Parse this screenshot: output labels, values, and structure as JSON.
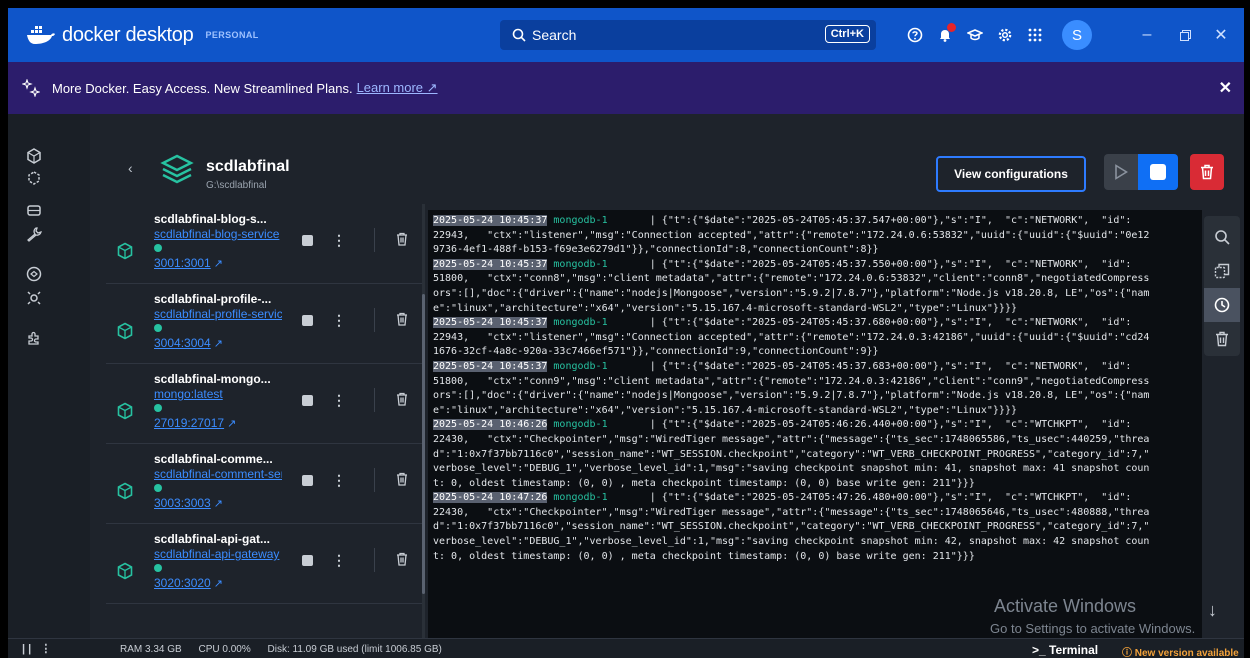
{
  "app": {
    "brand": "docker desktop",
    "tier": "PERSONAL",
    "search_label": "Search",
    "search_shortcut": "Ctrl+K",
    "avatar_initial": "S",
    "accent_color": "#0f55c9"
  },
  "banner": {
    "text": "More Docker. Easy Access. New Streamlined Plans.",
    "link": "Learn more ↗"
  },
  "project": {
    "name": "scdlabfinal",
    "path": "G:\\scdlabfinal",
    "view_config_label": "View configurations"
  },
  "containers": [
    {
      "name": "scdlabfinal-blog-s...",
      "image": "scdlabfinal-blog-service",
      "port": "3001:3001"
    },
    {
      "name": "scdlabfinal-profile-...",
      "image": "scdlabfinal-profile-service",
      "port": "3004:3004"
    },
    {
      "name": "scdlabfinal-mongo...",
      "image": "mongo:latest",
      "port": "27019:27017"
    },
    {
      "name": "scdlabfinal-comme...",
      "image": "scdlabfinal-comment-service",
      "port": "3003:3003"
    },
    {
      "name": "scdlabfinal-api-gat...",
      "image": "scdlabfinal-api-gateway",
      "port": "3020:3020"
    }
  ],
  "logs": [
    {
      "ts": "2025-05-24 10:45:37",
      "svc": "mongodb-1",
      "lines": [
        "       | {\"t\":{\"$date\":\"2025-05-24T05:45:37.547+00:00\"},\"s\":\"I\",  \"c\":\"NETWORK\",  \"id\":",
        "22943,   \"ctx\":\"listener\",\"msg\":\"Connection accepted\",\"attr\":{\"remote\":\"172.24.0.6:53832\",\"uuid\":{\"uuid\":{\"$uuid\":\"0e12",
        "9736-4ef1-488f-b153-f69e3e6279d1\"}},\"connectionId\":8,\"connectionCount\":8}}"
      ]
    },
    {
      "ts": "2025-05-24 10:45:37",
      "svc": "mongodb-1",
      "lines": [
        "       | {\"t\":{\"$date\":\"2025-05-24T05:45:37.550+00:00\"},\"s\":\"I\",  \"c\":\"NETWORK\",  \"id\":",
        "51800,   \"ctx\":\"conn8\",\"msg\":\"client metadata\",\"attr\":{\"remote\":\"172.24.0.6:53832\",\"client\":\"conn8\",\"negotiatedCompress",
        "ors\":[],\"doc\":{\"driver\":{\"name\":\"nodejs|Mongoose\",\"version\":\"5.9.2|7.8.7\"},\"platform\":\"Node.js v18.20.8, LE\",\"os\":{\"nam",
        "e\":\"linux\",\"architecture\":\"x64\",\"version\":\"5.15.167.4-microsoft-standard-WSL2\",\"type\":\"Linux\"}}}}"
      ]
    },
    {
      "ts": "2025-05-24 10:45:37",
      "svc": "mongodb-1",
      "lines": [
        "       | {\"t\":{\"$date\":\"2025-05-24T05:45:37.680+00:00\"},\"s\":\"I\",  \"c\":\"NETWORK\",  \"id\":",
        "22943,   \"ctx\":\"listener\",\"msg\":\"Connection accepted\",\"attr\":{\"remote\":\"172.24.0.3:42186\",\"uuid\":{\"uuid\":{\"$uuid\":\"cd24",
        "1676-32cf-4a8c-920a-33c7466ef571\"}},\"connectionId\":9,\"connectionCount\":9}}"
      ]
    },
    {
      "ts": "2025-05-24 10:45:37",
      "svc": "mongodb-1",
      "lines": [
        "       | {\"t\":{\"$date\":\"2025-05-24T05:45:37.683+00:00\"},\"s\":\"I\",  \"c\":\"NETWORK\",  \"id\":",
        "51800,   \"ctx\":\"conn9\",\"msg\":\"client metadata\",\"attr\":{\"remote\":\"172.24.0.3:42186\",\"client\":\"conn9\",\"negotiatedCompress",
        "ors\":[],\"doc\":{\"driver\":{\"name\":\"nodejs|Mongoose\",\"version\":\"5.9.2|7.8.7\"},\"platform\":\"Node.js v18.20.8, LE\",\"os\":{\"nam",
        "e\":\"linux\",\"architecture\":\"x64\",\"version\":\"5.15.167.4-microsoft-standard-WSL2\",\"type\":\"Linux\"}}}}"
      ]
    },
    {
      "ts": "2025-05-24 10:46:26",
      "svc": "mongodb-1",
      "lines": [
        "       | {\"t\":{\"$date\":\"2025-05-24T05:46:26.440+00:00\"},\"s\":\"I\",  \"c\":\"WTCHKPT\",  \"id\":",
        "22430,   \"ctx\":\"Checkpointer\",\"msg\":\"WiredTiger message\",\"attr\":{\"message\":{\"ts_sec\":1748065586,\"ts_usec\":440259,\"threa",
        "d\":\"1:0x7f37bb7116c0\",\"session_name\":\"WT_SESSION.checkpoint\",\"category\":\"WT_VERB_CHECKPOINT_PROGRESS\",\"category_id\":7,\"",
        "verbose_level\":\"DEBUG_1\",\"verbose_level_id\":1,\"msg\":\"saving checkpoint snapshot min: 41, snapshot max: 41 snapshot coun",
        "t: 0, oldest timestamp: (0, 0) , meta checkpoint timestamp: (0, 0) base write gen: 211\"}}}"
      ]
    },
    {
      "ts": "2025-05-24 10:47:26",
      "svc": "mongodb-1",
      "lines": [
        "       | {\"t\":{\"$date\":\"2025-05-24T05:47:26.480+00:00\"},\"s\":\"I\",  \"c\":\"WTCHKPT\",  \"id\":",
        "22430,   \"ctx\":\"Checkpointer\",\"msg\":\"WiredTiger message\",\"attr\":{\"message\":{\"ts_sec\":1748065646,\"ts_usec\":480888,\"threa",
        "d\":\"1:0x7f37bb7116c0\",\"session_name\":\"WT_SESSION.checkpoint\",\"category\":\"WT_VERB_CHECKPOINT_PROGRESS\",\"category_id\":7,\"",
        "verbose_level\":\"DEBUG_1\",\"verbose_level_id\":1,\"msg\":\"saving checkpoint snapshot min: 42, snapshot max: 42 snapshot coun",
        "t: 0, oldest timestamp: (0, 0) , meta checkpoint timestamp: (0, 0) base write gen: 211\"}}}"
      ]
    }
  ],
  "watermark": {
    "title": "Activate Windows",
    "subtitle": "Go to Settings to activate Windows."
  },
  "footer": {
    "ram": "RAM 3.34 GB",
    "cpu": "CPU 0.00%",
    "disk": "Disk: 11.09 GB used (limit 1006.85 GB)",
    "terminal": ">_ Terminal",
    "new_version": "ⓘ New version available"
  }
}
